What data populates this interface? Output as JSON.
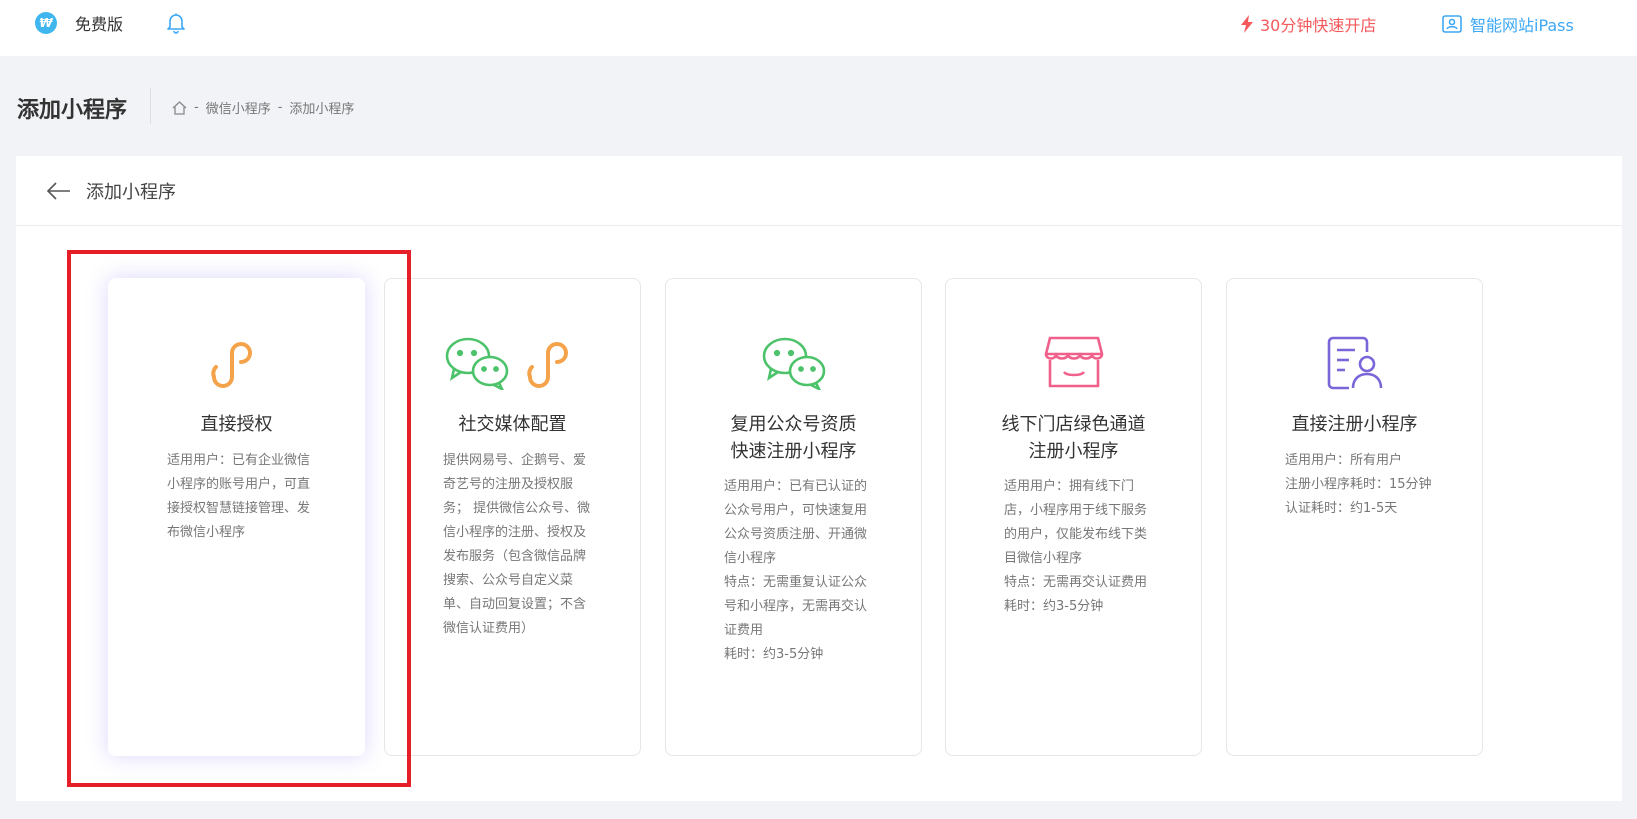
{
  "header": {
    "edition_label": "免费版",
    "promo_label": "30分钟快速开店",
    "ipass_label": "智能网站iPass",
    "accent_red": "#f5595c",
    "accent_blue": "#3da8f5"
  },
  "page": {
    "title": "添加小程序",
    "breadcrumb": [
      "微信小程序",
      "添加小程序"
    ]
  },
  "panel": {
    "title": "添加小程序"
  },
  "cards": [
    {
      "title": "直接授权",
      "icon": "mini-program-icon",
      "desc": "适用用户：已有企业微信小程序的账号用户，可直接授权智慧链接管理、发布微信小程序",
      "selected": true
    },
    {
      "title": "社交媒体配置",
      "icon": "wechat-and-mini-program-icons",
      "desc": "提供网易号、企鹅号、爱奇艺号的注册及授权服务； 提供微信公众号、微信小程序的注册、授权及发布服务（包含微信品牌搜索、公众号自定义菜单、自动回复设置；不含微信认证费用）"
    },
    {
      "title": "复用公众号资质\n快速注册小程序",
      "icon": "wechat-icon",
      "desc": "适用用户：已有已认证的公众号用户，可快速复用公众号资质注册、开通微信小程序\n特点：无需重复认证公众号和小程序，无需再交认证费用\n耗时：约3-5分钟"
    },
    {
      "title": "线下门店绿色通道\n注册小程序",
      "icon": "store-icon",
      "desc": "适用用户：拥有线下门店，小程序用于线下服务的用户，仅能发布线下类目微信小程序\n特点：无需再交认证费用\n耗时：约3-5分钟"
    },
    {
      "title": "直接注册小程序",
      "icon": "user-card-icon",
      "desc": "适用用户：所有用户\n注册小程序耗时：15分钟\n认证耗时：约1-5天"
    }
  ]
}
